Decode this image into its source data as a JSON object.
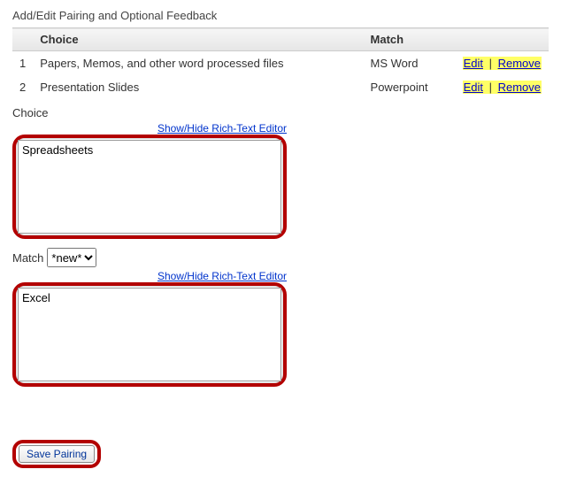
{
  "title": "Add/Edit Pairing and Optional Feedback",
  "table": {
    "headers": {
      "choice": "Choice",
      "match": "Match"
    },
    "rows": [
      {
        "num": "1",
        "choice": "Papers, Memos, and other word processed files",
        "match": "MS Word"
      },
      {
        "num": "2",
        "choice": "Presentation Slides",
        "match": "Powerpoint"
      }
    ],
    "actions": {
      "edit": "Edit",
      "remove": "Remove",
      "sep": " | "
    }
  },
  "form": {
    "choice_label": "Choice",
    "rte_link": "Show/Hide Rich-Text Editor",
    "choice_value": "Spreadsheets",
    "match_label": "Match",
    "match_selected": "*new*",
    "match_value": "Excel",
    "save_label": "Save Pairing"
  }
}
